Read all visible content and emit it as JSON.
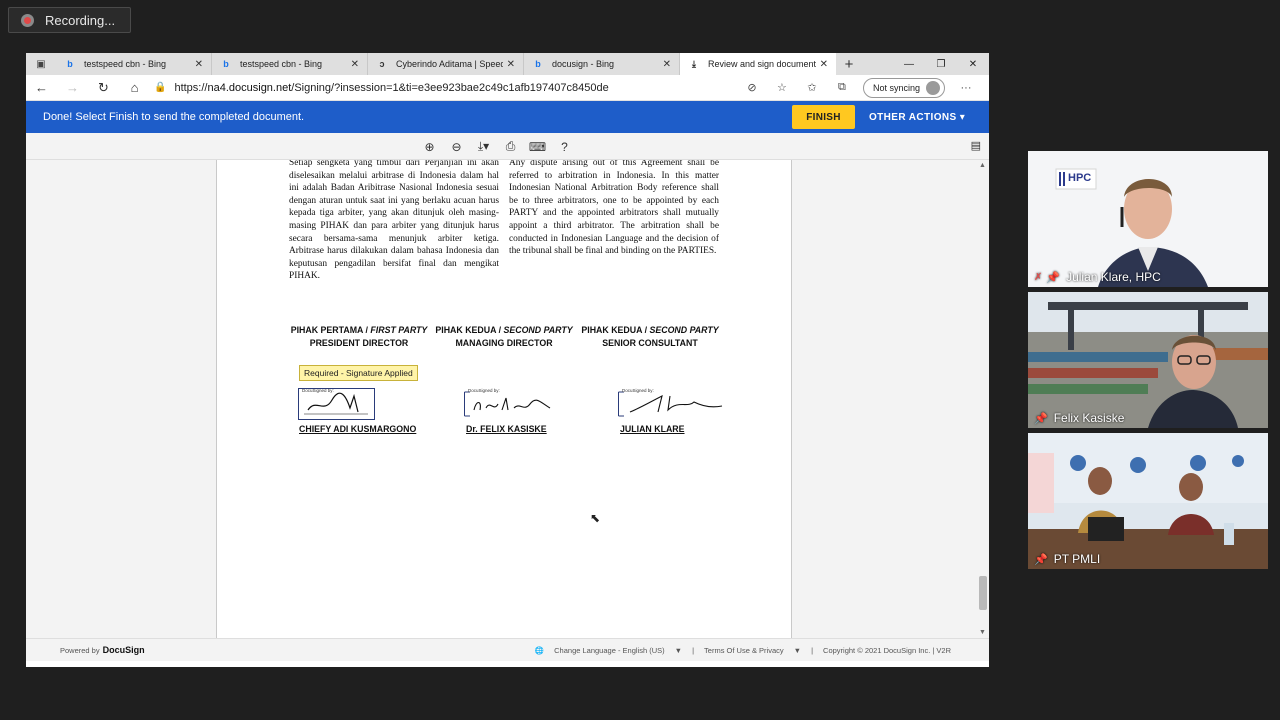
{
  "recording": {
    "label": "Recording..."
  },
  "browser": {
    "tabs": [
      {
        "title": "testspeed cbn - Bing",
        "icon": "bing-icon"
      },
      {
        "title": "testspeed cbn - Bing",
        "icon": "bing-icon"
      },
      {
        "title": "Cyberindo Aditama | Speedte",
        "icon": "cyberindo-icon"
      },
      {
        "title": "docusign - Bing",
        "icon": "bing-icon"
      },
      {
        "title": "Review and sign document(s)",
        "icon": "download-icon"
      }
    ],
    "url": {
      "prefix": "https://",
      "domain": "na4.docusign.net",
      "path": "/Signing/?insession=1&ti=e3ee923bae2c49c1afb197407c8450de"
    },
    "sync_label": "Not syncing"
  },
  "docusign": {
    "banner_message": "Done! Select Finish to send the completed document.",
    "finish_label": "FINISH",
    "other_actions_label": "OTHER ACTIONS ▾",
    "document": {
      "clause_id": "Setiap sengketa yang timbul dari Perjanjian ini akan diselesaikan melalui arbitrase di Indonesia dalam hal ini adalah Badan Aribitrase Nasional Indonesia sesuai dengan aturan untuk saat ini yang berlaku acuan harus kepada tiga arbiter, yang akan ditunjuk oleh masing-masing PIHAK dan para arbiter yang ditunjuk harus secara bersama-sama menunjuk arbiter ketiga. Arbitrase harus dilakukan dalam bahasa Indonesia dan keputusan pengadilan bersifat final dan mengikat PIHAK.",
      "clause_en": "Any dispute arising out of this Agreement shall be referred to arbitration in Indonesia. In this matter Indonesian National Arbitration Body reference shall be to three arbitrators, one to be appointed by each PARTY and the appointed arbitrators shall mutually appoint a third arbitrator. The arbitration shall be conducted in Indonesian Language and the decision of the tribunal shall be final and binding on the PARTIES.",
      "parties": [
        {
          "label_local": "PIHAK PERTAMA / ",
          "label_en": "FIRST PARTY",
          "role": "PRESIDENT DIRECTOR",
          "signer": "CHIEFY ADI KUSMARGONO",
          "sig_caption": "DocuSigned by:"
        },
        {
          "label_local": "PIHAK KEDUA / ",
          "label_en": "SECOND PARTY",
          "role": "MANAGING DIRECTOR",
          "signer": "Dr. FELIX KASISKE",
          "sig_caption": "DocuSigned by:"
        },
        {
          "label_local": "PIHAK KEDUA / ",
          "label_en": "SECOND PARTY",
          "role": "SENIOR CONSULTANT",
          "signer": "JULIAN KLARE",
          "sig_caption": "DocuSigned by:"
        }
      ],
      "required_tag": "Required - Signature Applied"
    },
    "footer": {
      "powered_by": "Powered by",
      "brand": "DocuSign",
      "language": "Change Language - English (US)",
      "terms": "Terms Of Use & Privacy",
      "copyright": "Copyright © 2021 DocuSign Inc. | V2R"
    }
  },
  "participants": [
    {
      "name": "Julian Klare, HPC",
      "badge": "HPC"
    },
    {
      "name": "Felix Kasiske"
    },
    {
      "name": "PT PMLI"
    }
  ]
}
